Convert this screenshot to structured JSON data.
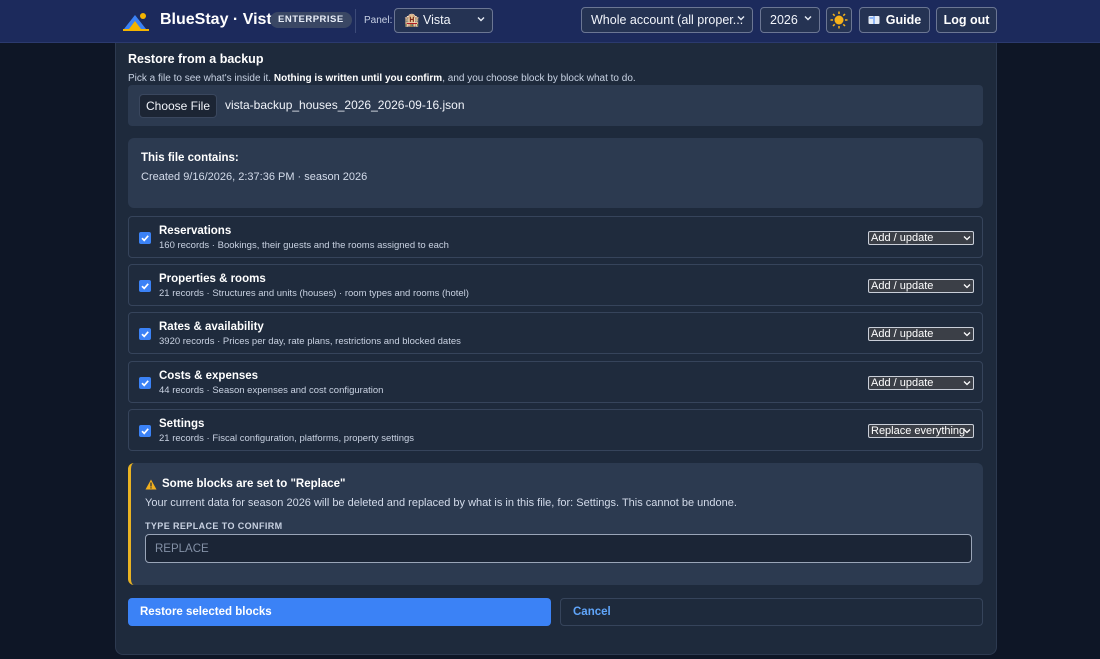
{
  "header": {
    "brand": "BlueStay · Vista",
    "edition_badge": "ENTERPRISE",
    "panel_label": "Panel:",
    "panel_value": "🏨 Vista",
    "account_value": "Whole account (all proper...",
    "year_value": "2026",
    "guide_label": "Guide",
    "logout_label": "Log out",
    "icons": [
      "logo-icon",
      "sun-icon",
      "book-icon",
      "chevron-down-icon"
    ]
  },
  "restore": {
    "title": "Restore from a backup",
    "subtitle_pre": "Pick a file to see what's inside it. ",
    "subtitle_bold": "Nothing is written until you confirm",
    "subtitle_post": ", and you choose block by block what to do.",
    "choose_file_label": "Choose File",
    "file_name": "vista-backup_houses_2026_2026-09-16.json"
  },
  "file_info": {
    "title": "This file contains:",
    "created": "Created 9/16/2026, 2:37:36 PM · season 2026"
  },
  "blocks": [
    {
      "title": "Reservations",
      "desc": "160 records · Bookings, their guests and the rooms assigned to each",
      "checked": true,
      "action": "Add / update"
    },
    {
      "title": "Properties & rooms",
      "desc": "21 records · Structures and units (houses) · room types and rooms (hotel)",
      "checked": true,
      "action": "Add / update"
    },
    {
      "title": "Rates & availability",
      "desc": "3920 records · Prices per day, rate plans, restrictions and blocked dates",
      "checked": true,
      "action": "Add / update"
    },
    {
      "title": "Costs & expenses",
      "desc": "44 records · Season expenses and cost configuration",
      "checked": true,
      "action": "Add / update"
    },
    {
      "title": "Settings",
      "desc": "21 records · Fiscal configuration, platforms, property settings",
      "checked": true,
      "action": "Replace everything"
    }
  ],
  "warning": {
    "title": "Some blocks are set to \"Replace\"",
    "text": "Your current data for season 2026 will be deleted and replaced by what is in this file, for: Settings. This cannot be undone.",
    "confirm_label": "TYPE REPLACE TO CONFIRM",
    "confirm_placeholder": "REPLACE",
    "confirm_value": ""
  },
  "actions": {
    "restore_label": "Restore selected blocks",
    "cancel_label": "Cancel"
  },
  "colors": {
    "topbar": "#1c2a5c",
    "background": "#0e1626",
    "card": "#1e2a3c",
    "accent": "#3b82f6",
    "warning": "#e9b323",
    "link": "#60a5fa"
  }
}
